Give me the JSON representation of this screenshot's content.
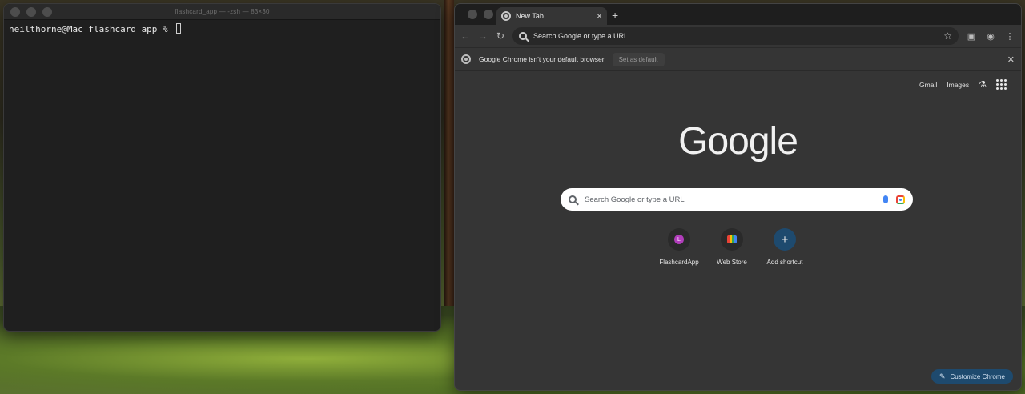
{
  "terminal": {
    "title": "flashcard_app — -zsh — 83×30",
    "prompt": "neilthorne@Mac flashcard_app % "
  },
  "chrome": {
    "tab_title": "New Tab",
    "omnibox_placeholder": "Search Google or type a URL",
    "infobar": {
      "message": "Google Chrome isn't your default browser",
      "button": "Set as default"
    },
    "ntp": {
      "top_links": [
        "Gmail",
        "Images"
      ],
      "logo": "Google",
      "search_placeholder": "Search Google or type a URL",
      "shortcuts": [
        {
          "label": "FlashcardApp",
          "avatar_letter": "L"
        },
        {
          "label": "Web Store"
        },
        {
          "label": "Add shortcut"
        }
      ],
      "customize_label": "Customize Chrome"
    }
  },
  "colors": {
    "accent": "#1e4a6e",
    "avatar": "#b13dbb"
  }
}
